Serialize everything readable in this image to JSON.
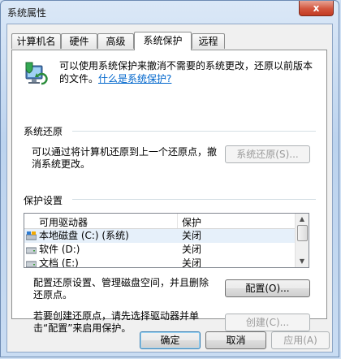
{
  "window": {
    "title": "系统属性",
    "close_glyph": "x"
  },
  "tabs": [
    {
      "label": "计算机名"
    },
    {
      "label": "硬件"
    },
    {
      "label": "高级"
    },
    {
      "label": "系统保护"
    },
    {
      "label": "远程"
    }
  ],
  "intro": {
    "text": "可以使用系统保护来撤消不需要的系统更改，还原以前版本的文件。",
    "link": "什么是系统保护?"
  },
  "restore": {
    "title": "系统还原",
    "description": "可以通过将计算机还原到上一个还原点，撤消系统更改。",
    "button": "系统还原(S)..."
  },
  "protection": {
    "title": "保护设置",
    "columns": [
      "可用驱动器",
      "保护"
    ],
    "drives": [
      {
        "name": "本地磁盘  (C:) (系统)",
        "protection": "关闭",
        "selected": true
      },
      {
        "name": "软件  (D:)",
        "protection": "关闭",
        "selected": false
      },
      {
        "name": "文档  (E:)",
        "protection": "关闭",
        "selected": false
      }
    ],
    "configure_text": "配置还原设置、管理磁盘空间，并且删除还原点。",
    "configure_button": "配置(O)...",
    "create_text": "若要创建还原点，请先选择驱动器并单击“配置”来启用保护。",
    "create_button": "创建(C)..."
  },
  "footer": {
    "ok": "确定",
    "cancel": "取消",
    "apply": "应用(A)"
  },
  "colors": {
    "link": "#0066cc",
    "close": "#c23b22",
    "selected_row": "#e6f0fa"
  }
}
